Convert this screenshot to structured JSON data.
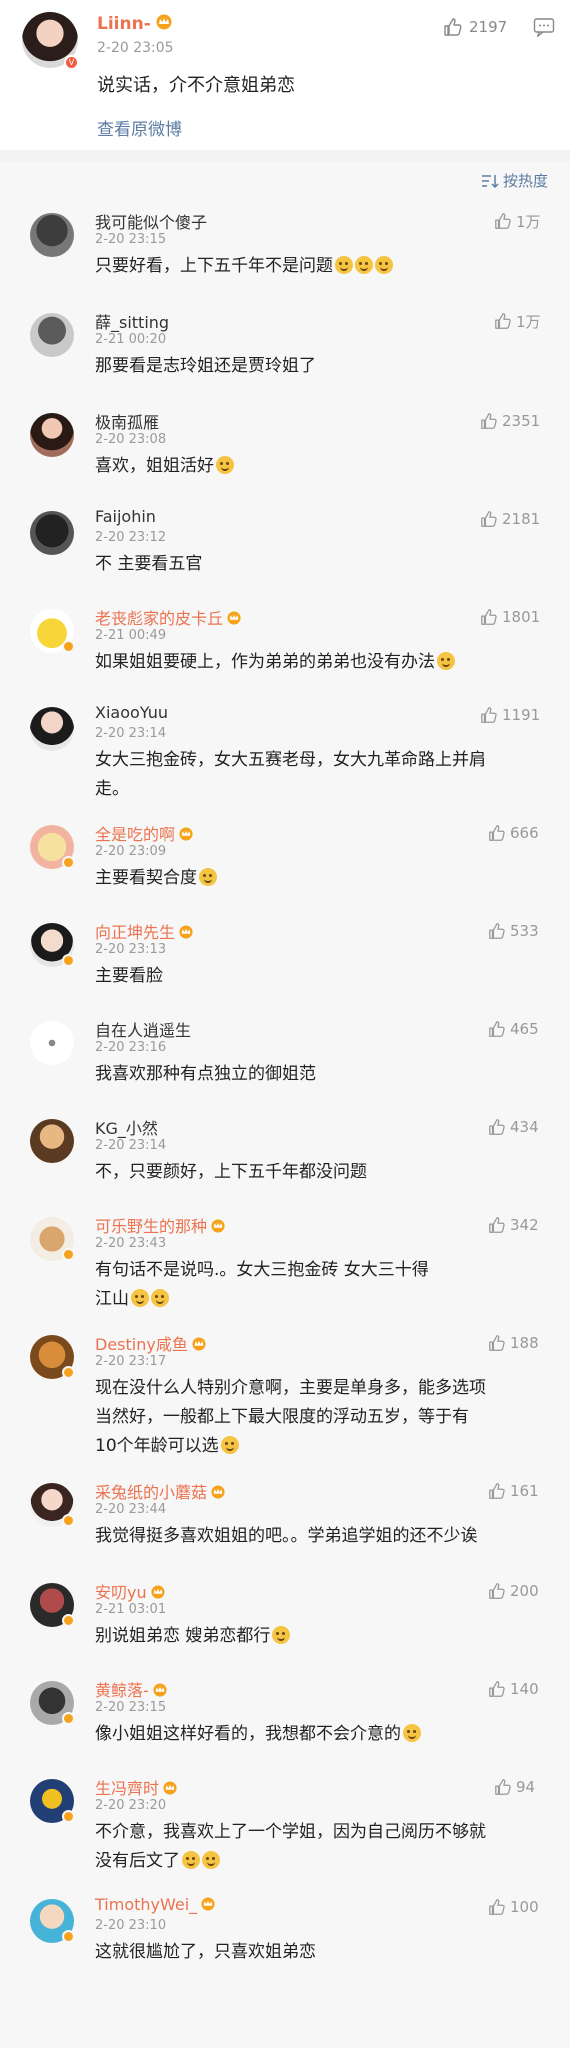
{
  "post": {
    "author": "Liinn-",
    "time": "2-20 23:05",
    "likes": "2197",
    "text": "说实话，介不介意姐弟恋",
    "view_original": "查看原微博"
  },
  "sort_label": "按热度",
  "colors": {
    "vip_name": "#eb7350",
    "link": "#5d7ca4",
    "muted": "#999999"
  },
  "comments": [
    {
      "name": "我可能似个傻子",
      "vip": false,
      "time": "2-20 23:15",
      "likes": "1万",
      "lines": [
        "只要好看，上下五千年不是问题"
      ],
      "emoji_count": 3
    },
    {
      "name": "薛_sitting",
      "vip": false,
      "time": "2-21 00:20",
      "likes": "1万",
      "lines": [
        "那要看是志玲姐还是贾玲姐了"
      ],
      "emoji_count": 0
    },
    {
      "name": "极南孤雁",
      "vip": false,
      "time": "2-20 23:08",
      "likes": "2351",
      "lines": [
        "喜欢，姐姐活好"
      ],
      "emoji_count": 1
    },
    {
      "name": "Faijohin",
      "vip": false,
      "time": "2-20 23:12",
      "likes": "2181",
      "lines": [
        "不 主要看五官"
      ],
      "emoji_count": 0
    },
    {
      "name": "老丧彪家的皮卡丘",
      "vip": true,
      "time": "2-21 00:49",
      "likes": "1801",
      "lines": [
        "如果姐姐要硬上，作为弟弟的弟弟也没有办法"
      ],
      "emoji_count": 1
    },
    {
      "name": "XiaooYuu",
      "vip": false,
      "time": "2-20 23:14",
      "likes": "1191",
      "lines": [
        "女大三抱金砖，女大五赛老母，女大九革命路上并肩",
        "走。"
      ],
      "emoji_count": 0
    },
    {
      "name": "全是吃的啊",
      "vip": true,
      "time": "2-20 23:09",
      "likes": "666",
      "lines": [
        "主要看契合度"
      ],
      "emoji_count": 1
    },
    {
      "name": "向正坤先生",
      "vip": true,
      "time": "2-20 23:13",
      "likes": "533",
      "lines": [
        "主要看脸"
      ],
      "emoji_count": 0
    },
    {
      "name": "自在人逍遥生",
      "vip": false,
      "time": "2-20 23:16",
      "likes": "465",
      "lines": [
        "我喜欢那种有点独立的御姐范"
      ],
      "emoji_count": 0
    },
    {
      "name": "KG_小然",
      "vip": false,
      "time": "2-20 23:14",
      "likes": "434",
      "lines": [
        "不，只要颜好，上下五千年都没问题"
      ],
      "emoji_count": 0
    },
    {
      "name": "可乐野生的那种",
      "vip": true,
      "time": "2-20 23:43",
      "likes": "342",
      "lines": [
        "有句话不是说吗.。女大三抱金砖          女大三十得",
        "江山"
      ],
      "emoji_count": 2
    },
    {
      "name": "Destiny咸鱼",
      "vip": true,
      "time": "2-20 23:17",
      "likes": "188",
      "lines": [
        "现在没什么人特别介意啊，主要是单身多，能多选项",
        "当然好，一般都上下最大限度的浮动五岁，等于有",
        "10个年龄可以选"
      ],
      "emoji_count": 1
    },
    {
      "name": "采兔纸的小蘑菇",
      "vip": true,
      "time": "2-20 23:44",
      "likes": "161",
      "lines": [
        "我觉得挺多喜欢姐姐的吧。。学弟追学姐的还不少诶"
      ],
      "emoji_count": 0
    },
    {
      "name": "安叨yu",
      "vip": true,
      "time": "2-21 03:01",
      "likes": "200",
      "lines": [
        "别说姐弟恋 嫂弟恋都行"
      ],
      "emoji_count": 1
    },
    {
      "name": "黄鲸落-",
      "vip": true,
      "time": "2-20 23:15",
      "likes": "140",
      "lines": [
        "像小姐姐这样好看的，我想都不会介意的"
      ],
      "emoji_count": 1
    },
    {
      "name": "生冯齊时",
      "vip": true,
      "time": "2-20 23:20",
      "likes": "94",
      "lines": [
        "不介意，我喜欢上了一个学姐，因为自己阅历不够就",
        "没有后文了"
      ],
      "emoji_count": 2
    },
    {
      "name": "TimothyWei_",
      "vip": true,
      "time": "2-20 23:10",
      "likes": "100",
      "lines": [
        "这就很尴尬了，只喜欢姐弟恋"
      ],
      "emoji_count": 0
    }
  ]
}
